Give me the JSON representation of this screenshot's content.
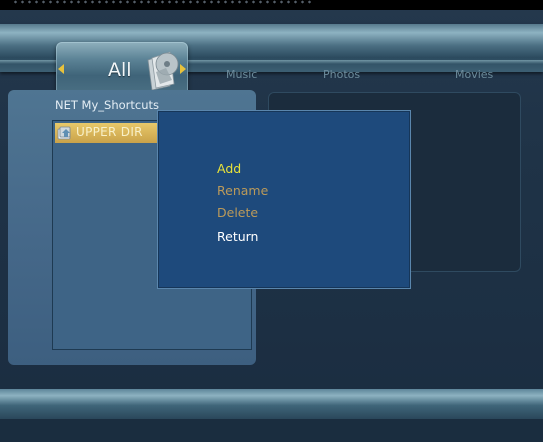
{
  "nav": {
    "tabs": [
      {
        "label": "All",
        "selected": true
      },
      {
        "label": "Music",
        "selected": false
      },
      {
        "label": "Photos",
        "selected": false
      },
      {
        "label": "Movies",
        "selected": false
      }
    ],
    "arrow_color": "#e8c23c",
    "selected_icon": "media-all-icon"
  },
  "browser": {
    "path": "NET  My_Shortcuts",
    "items": [
      {
        "label": "UPPER DIR",
        "icon": "upper-dir-icon",
        "selected": true
      }
    ]
  },
  "popup": {
    "items": [
      {
        "label": "Add",
        "state": "focused",
        "color": "#e8e23a"
      },
      {
        "label": "Rename",
        "state": "disabled",
        "color": "#bb9a5a"
      },
      {
        "label": "Delete",
        "state": "disabled",
        "color": "#bb9a5a"
      },
      {
        "label": "Return",
        "state": "enabled",
        "color": "#ffffff"
      }
    ]
  }
}
